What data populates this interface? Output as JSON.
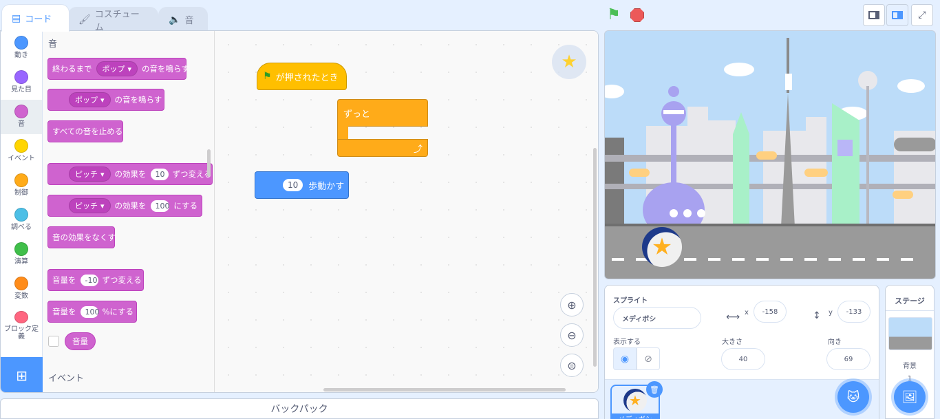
{
  "tabs": {
    "code": "コード",
    "costumes": "コスチューム",
    "sounds": "音"
  },
  "categories": [
    {
      "label": "動き",
      "color": "#4c97ff"
    },
    {
      "label": "見た目",
      "color": "#9966ff"
    },
    {
      "label": "音",
      "color": "#cf63cf"
    },
    {
      "label": "イベント",
      "color": "#ffd500"
    },
    {
      "label": "制御",
      "color": "#ffab19"
    },
    {
      "label": "調べる",
      "color": "#4cbfe6"
    },
    {
      "label": "演算",
      "color": "#40bf4a"
    },
    {
      "label": "変数",
      "color": "#ff8c1a"
    },
    {
      "label": "ブロック定義",
      "color": "#ff6680"
    }
  ],
  "flyout": {
    "heading": "音",
    "play_until_done": {
      "pre": "終わるまで",
      "menu": "ポップ",
      "post": "の音を鳴らす"
    },
    "start_sound": {
      "menu": "ポップ",
      "post": "の音を鳴らす"
    },
    "stop_all": "すべての音を止める",
    "change_effect": {
      "menu": "ピッチ",
      "mid": "の効果を",
      "value": "10",
      "post": "ずつ変える"
    },
    "set_effect": {
      "menu": "ピッチ",
      "mid": "の効果を",
      "value": "100",
      "post": "にする"
    },
    "clear_effects": "音の効果をなくす",
    "change_volume": {
      "pre": "音量を",
      "value": "-10",
      "post": "ずつ変える"
    },
    "set_volume": {
      "pre": "音量を",
      "value": "100",
      "post": "%にする"
    },
    "volume_reporter": "音量",
    "next_heading": "イベント"
  },
  "workspace": {
    "hat_label": "が押されたとき",
    "forever_label": "ずっと",
    "move": {
      "value": "10",
      "label": "歩動かす"
    }
  },
  "backpack_label": "バックパック",
  "sprite_info": {
    "sprite_label": "スプライト",
    "sprite_name": "メディボシ",
    "x_label": "x",
    "x_value": "-158",
    "y_label": "y",
    "y_value": "-133",
    "show_label": "表示する",
    "size_label": "大きさ",
    "size_value": "40",
    "direction_label": "向き",
    "direction_value": "69"
  },
  "sprite_list": [
    {
      "name": "メディボシ",
      "selected": true
    }
  ],
  "stage_panel": {
    "title": "ステージ",
    "backdrops_label": "背景",
    "backdrop_count": "1"
  },
  "colors": {
    "motion": "#4c97ff",
    "sound": "#cf63cf",
    "events": "#ffbf00",
    "control": "#ffab19",
    "accent": "#4c97ff"
  }
}
